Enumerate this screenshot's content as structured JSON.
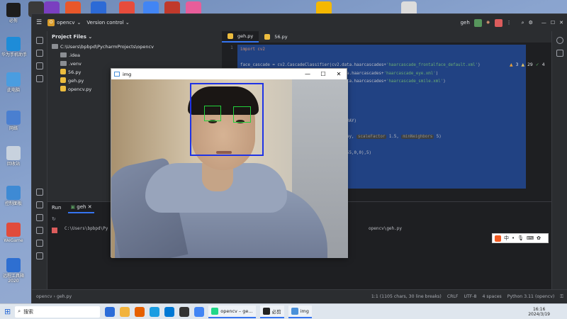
{
  "desktop": {
    "icons": [
      {
        "label": "必剪",
        "color": "#1d1d1d"
      },
      {
        "label": "华为手机助手",
        "color": "#1e8cd8"
      },
      {
        "label": "此电脑",
        "color": "#4a9de0"
      },
      {
        "label": "网络",
        "color": "#4a7fd0"
      },
      {
        "label": "回收站",
        "color": "#c8d2de"
      },
      {
        "label": "控制面板",
        "color": "#3e8ad4"
      },
      {
        "label": "WeGame",
        "color": "#e14b3b"
      },
      {
        "label": "远程工具箱\n2020",
        "color": "#2e6fd1"
      }
    ],
    "top_icons": [
      "#3a3a3a",
      "#7a3fc0",
      "#e8572a",
      "#2c6ad6",
      "#e74c3c",
      "#4285f4",
      "#c0392b",
      "#e85d9a",
      "#f5b800",
      "#dcdcdc"
    ]
  },
  "ide": {
    "project_name": "opencv",
    "project_badge": "O",
    "version_control": "Version control",
    "run_config": "geh",
    "project_panel_title": "Project Files",
    "tree": [
      {
        "label": "C:\\Users\\bpbpd\\PycharmProjects\\opencv",
        "type": "folder",
        "indent": 0
      },
      {
        "label": ".idea",
        "type": "folder",
        "indent": 1
      },
      {
        "label": ".venv",
        "type": "folder",
        "indent": 1
      },
      {
        "label": "56.py",
        "type": "py",
        "indent": 1
      },
      {
        "label": "geh.py",
        "type": "py",
        "indent": 1
      },
      {
        "label": "opencv.py",
        "type": "py",
        "indent": 1
      }
    ],
    "tabs": [
      {
        "label": "geh.py",
        "active": true
      },
      {
        "label": "56.py",
        "active": false
      }
    ],
    "line_numbers": [
      "1"
    ],
    "inspections": {
      "warnings": "3",
      "weak": "29",
      "typos": "4"
    },
    "code_lines": [
      {
        "segments": [
          {
            "t": "import cv2",
            "c": "kw"
          }
        ]
      },
      {
        "segments": [
          {
            "t": "",
            "c": ""
          }
        ]
      },
      {
        "segments": [
          {
            "t": "face_cascade = cv2.CascadeClassifier(cv2.",
            "c": ""
          },
          {
            "t": "data",
            "c": ""
          },
          {
            "t": ".haarcascades+",
            "c": ""
          },
          {
            "t": "'haarcascade_frontalface_default.xml'",
            "c": "st"
          },
          {
            "t": ")",
            "c": ""
          }
        ]
      },
      {
        "segments": [
          {
            "t": "                                    cv2.",
            "c": ""
          },
          {
            "t": "data",
            "c": ""
          },
          {
            "t": ".haarcascades+",
            "c": ""
          },
          {
            "t": "'haarcascade_eye.xml'",
            "c": "st"
          },
          {
            "t": ")",
            "c": ""
          }
        ]
      },
      {
        "segments": [
          {
            "t": "                                    (cv2.data.haarcascades+",
            "c": ""
          },
          {
            "t": "'haarcascade_smile.xml'",
            "c": "st"
          },
          {
            "t": ")",
            "c": ""
          }
        ]
      },
      {
        "segments": [
          {
            "t": "",
            "c": ""
          }
        ]
      },
      {
        "segments": [
          {
            "t": "",
            "c": ""
          }
        ]
      },
      {
        "segments": [
          {
            "t": "",
            "c": ""
          }
        ]
      },
      {
        "segments": [
          {
            "t": "",
            "c": ""
          }
        ]
      },
      {
        "segments": [
          {
            "t": "                                    R_BGR2GRAY)",
            "c": ""
          }
        ]
      },
      {
        "segments": [
          {
            "t": "",
            "c": ""
          }
        ]
      },
      {
        "segments": [
          {
            "t": "                                    cale(gray, ",
            "c": ""
          },
          {
            "t": "scaleFactor",
            "c": "hint"
          },
          {
            "t": " 1.5, ",
            "c": ""
          },
          {
            "t": "minNeighbors",
            "c": "hint"
          },
          {
            "t": " 5)",
            "c": ""
          }
        ]
      },
      {
        "segments": [
          {
            "t": "",
            "c": ""
          }
        ]
      },
      {
        "segments": [
          {
            "t": "                                    y+h),(255,0,0),5)",
            "c": ""
          }
        ]
      }
    ],
    "run": {
      "title": "Run",
      "tab": "geh",
      "console_lines": [
        "C:\\Users\\bpbpd\\Py",
        "opencv\\geh.py"
      ]
    },
    "status": {
      "breadcrumb_project": "opencv",
      "breadcrumb_file": "geh.py",
      "position": "1:1 (1105 chars, 30 line breaks)",
      "line_sep": "CRLF",
      "encoding": "UTF-8",
      "indent": "4 spaces",
      "interpreter": "Python 3.11 (opencv)"
    }
  },
  "img_window": {
    "title": "img",
    "minimize": "—",
    "maximize": "☐",
    "close": "✕"
  },
  "ime": {
    "label": "中"
  },
  "taskbar": {
    "search_placeholder": "搜索",
    "apps": [
      {
        "label": "opencv – ge...",
        "color": "#21d789"
      },
      {
        "label": "必剪",
        "color": "#222"
      },
      {
        "label": "img",
        "color": "#4a90d9"
      }
    ],
    "time": "16:16",
    "date": "2024/3/19"
  }
}
